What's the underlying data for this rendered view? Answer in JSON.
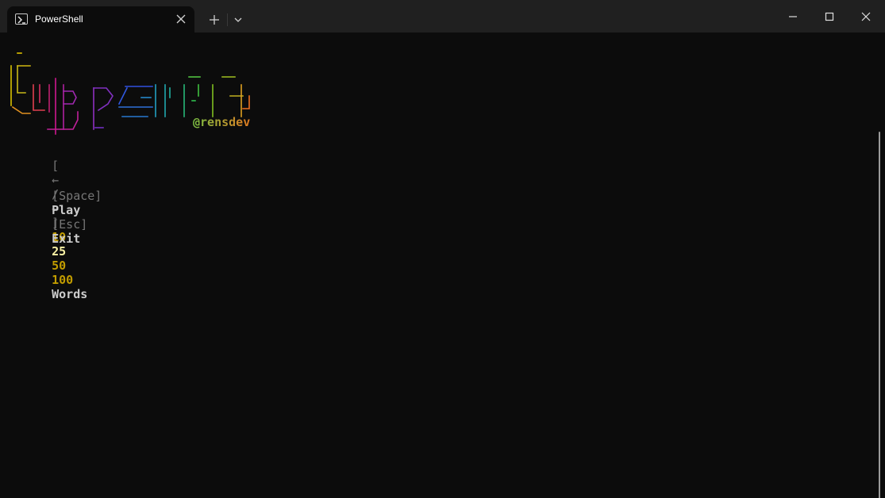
{
  "window": {
    "tab_title": "PowerShell",
    "tab_icon": "powershell-icon",
    "icons": [
      "close-icon",
      "plus-icon",
      "chevron-down-icon",
      "minimize-icon",
      "maximize-icon",
      "close-window-icon"
    ]
  },
  "app": {
    "logo_text": "typerr",
    "logo_colors": [
      "#e0c000",
      "#c0c020",
      "#e03050",
      "#c02070",
      "#d01890",
      "#8030c0",
      "#3050e0",
      "#2090d0",
      "#20b0a0",
      "#30c040",
      "#80c020",
      "#e0a020",
      "#f06020"
    ],
    "handle": "@rensdev",
    "handle_colors": [
      "#7ac043",
      "#e07a20"
    ]
  },
  "menu": {
    "bracket_open": "[",
    "left_arrow": "←",
    "slash": "/",
    "right_arrow": "→",
    "bracket_close": "]",
    "options": [
      "10",
      "25",
      "50",
      "100"
    ],
    "selected": "25",
    "unit": "Words"
  },
  "keys": {
    "play_key": "[Space]",
    "play_label": "Play",
    "exit_key": "[Esc]",
    "exit_label": "Exit"
  },
  "colors": {
    "background": "#0c0c0c",
    "titlebar": "#202020",
    "option": "#c19c00",
    "option_selected": "#f9f1a5",
    "dim": "#767676"
  }
}
